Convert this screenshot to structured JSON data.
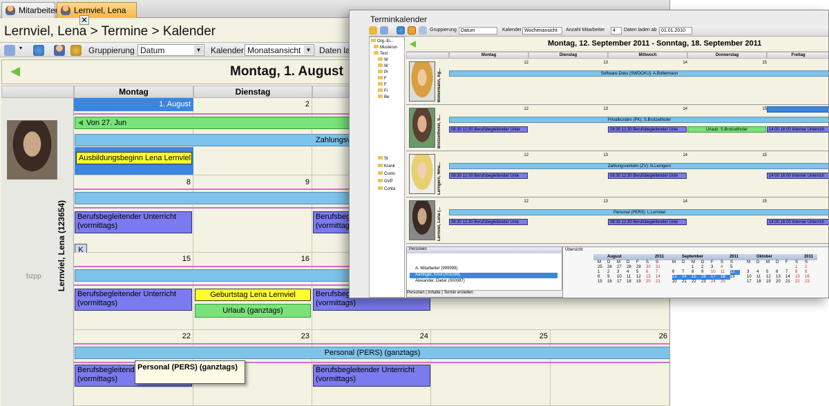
{
  "tabs": [
    {
      "label": "Mitarbeiter",
      "active": false
    },
    {
      "label": "Lernviel, Lena",
      "active": true
    }
  ],
  "breadcrumb": "Lernviel, Lena > Termine > Kalender",
  "toolbar": {
    "grouping_label": "Gruppierung",
    "grouping_value": "Datum",
    "calendar_label": "Kalender",
    "calendar_value": "Monatsansicht",
    "load_label": "Daten la"
  },
  "date_title": "Montag, 1. August",
  "day_headers": [
    "Montag",
    "Dienstag"
  ],
  "person": {
    "name": "Lernviel, Lena (123654)",
    "caption": "bzpp"
  },
  "weeks": [
    {
      "nums": [
        "1. August",
        "2"
      ],
      "bars": {
        "green": "Von 27. Jun",
        "blue": "Zahlungsv",
        "yellow": "Ausbildungsbeginn Lena Lernviel"
      }
    },
    {
      "nums": [
        "8",
        "9"
      ],
      "bars": {
        "purple1": "Berufsbegleitender Unterricht (vormittags)",
        "purple3": "Berufsbegleitender Unterricht (vormittags)"
      }
    },
    {
      "nums": [
        "15",
        "16"
      ],
      "bars": {
        "purple1": "Berufsbegleitender Unterricht (vormittags)",
        "yellow": "Geburtstag  Lena Lernviel",
        "green": "Urlaub (ganztags)",
        "purple3": "Berufsbegleitender Unterricht (vormittags)"
      }
    },
    {
      "nums": [
        "22",
        "23",
        "24",
        "25",
        "26"
      ],
      "bars": {
        "blue": "Personal (PERS) (ganztags)",
        "purple1": "Berufsbegleitender Unterricht (vormittags)",
        "purple3": "Berufsbegleitender Unterricht (vormittags)"
      }
    }
  ],
  "tooltip": "Personal (PERS) (ganztags)",
  "nav_button": "K",
  "overlay": {
    "title": "Terminkalender",
    "toolbar": {
      "grouping_label": "Gruppierung",
      "grouping_value": "Datum",
      "calendar_label": "Kalender",
      "calendar_value": "Wochenansicht",
      "count_label": "Anzahl Mitarbeiter",
      "count_value": "4",
      "load_label": "Daten laden ab",
      "load_value": "01.01.2010"
    },
    "date_title": "Montag, 12. September 2011 - Sonntag, 18. September 2011",
    "days": [
      "Montag",
      "Dienstag",
      "Mittwoch",
      "Donnerstag",
      "Freitag"
    ],
    "day_nums": [
      "12",
      "13",
      "14",
      "15"
    ],
    "tree": [
      "Org.-Ei...",
      "Musterun",
      "Test",
      "W",
      "W",
      "Pr",
      "F",
      "F",
      "Fi",
      "Be",
      "St",
      "Krank",
      "Custo",
      "GVP",
      "Conta"
    ],
    "rows": [
      {
        "name": "Bollermann, Ag...",
        "top_bar": "Software-Doku (SWDOKU): A.Bollermann",
        "items": []
      },
      {
        "name": "Brotzeitholer, S...",
        "top_bar": "Privatkunden (PK): S.Brotzeitholer",
        "items": [
          "08:30  12:30  Berufsbegleitender Unter",
          "08:30  12:30  Berufsbegleitender Unte",
          "Urlaub: S.Brotzeitholer",
          "14:00  16:00  Interner Unterrich"
        ]
      },
      {
        "name": "Lerngern, Nina...",
        "top_bar": "Zahlungsverkehr (ZV): N.Lerngern",
        "items": [
          "08:30  12:30  Berufsbegleitender Unte",
          "08:30  12:30  Berufsbegleitender Unte",
          "14:00  16:00  Interner Unterrich"
        ]
      },
      {
        "name": "Lernviel, Lena (...",
        "top_bar": "Personal (PERS): L.Lernviel",
        "items": [
          "08:30  12:30  Berufsbegleitender Unte",
          "08:30  12:30  Berufsbegleitender Unte",
          "14:00  16:00  Interner Unterrich"
        ]
      }
    ],
    "persons": {
      "title": "Personen",
      "rows": [
        "A, Mitarbeiter (999999)",
        "Aarlinger, Knut (001098)",
        "Alexander, Dieter (000087)"
      ],
      "tabs": "Personen | Inhalte | Termin erstellen"
    },
    "uebersicht": {
      "title": "Übersicht",
      "months": [
        {
          "name": "August",
          "year": "2011",
          "rows": [
            "25 26 27 28 29 30 31",
            "1 2 3 4 5 6 7",
            "8 9 10 11 12 13 14",
            "15 16 17 18 19 20 21"
          ]
        },
        {
          "name": "September",
          "year": "2011",
          "rows": [
            "  1 2 3 4",
            "5 6 7 8 9 10 11",
            "12 13 14 15 16 17 18",
            "19 20 21 22 23 24 25"
          ]
        },
        {
          "name": "Oktober",
          "year": "2011",
          "rows": [
            "     1 2",
            "3 4 5 6 7 8 9",
            "10 11 12 13 14 15 16",
            "17 18 19 20 21 22 23"
          ]
        }
      ],
      "weekdays": "M D M D F S S"
    }
  }
}
